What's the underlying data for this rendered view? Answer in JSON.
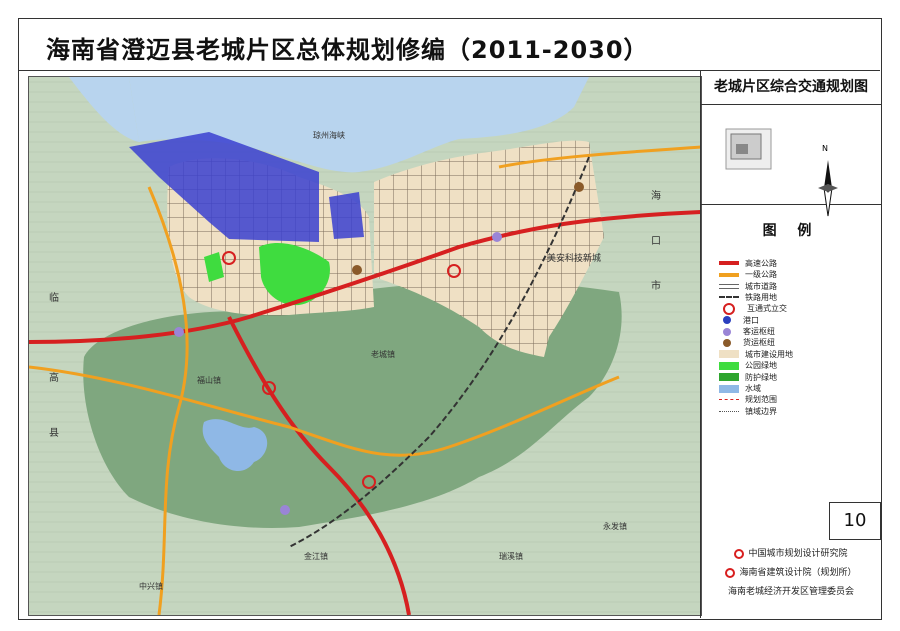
{
  "title": "海南省澄迈县老城片区总体规划修编（2011-2030）",
  "sidebar": {
    "map_title": "老城片区综合交通规划图",
    "compass_label": "N",
    "legend_heading": "图 例",
    "legend": [
      {
        "label": "高速公路",
        "color": "#d62020",
        "style": "thick"
      },
      {
        "label": "一级公路",
        "color": "#f0a020",
        "style": "thick"
      },
      {
        "label": "城市道路",
        "color": "#666666",
        "style": "double"
      },
      {
        "label": "铁路用地",
        "color": "#333333",
        "style": "rail"
      },
      {
        "label": "互通式立交",
        "color": "#d62020",
        "style": "ring"
      },
      {
        "label": "港口",
        "color": "#2b3fbf",
        "style": "anchor"
      },
      {
        "label": "客运枢纽",
        "color": "#9a85d6",
        "style": "dot"
      },
      {
        "label": "货运枢纽",
        "color": "#8a5a2a",
        "style": "dot"
      },
      {
        "label": "城市建设用地",
        "color": "#efe0c4",
        "style": "fill"
      },
      {
        "label": "公园绿地",
        "color": "#3fdc3f",
        "style": "fill"
      },
      {
        "label": "防护绿地",
        "color": "#2ea52e",
        "style": "fill"
      },
      {
        "label": "水域",
        "color": "#8fb8e6",
        "style": "fill"
      },
      {
        "label": "规划范围",
        "color": "#d62020",
        "style": "dash"
      },
      {
        "label": "镇域边界",
        "color": "#555555",
        "style": "dashdot"
      }
    ],
    "page_number": "10",
    "credits": [
      "中国城市规划设计研究院",
      "海南省建筑设计院（规划所）",
      "海南老城经济开发区管理委员会"
    ]
  },
  "map_labels": {
    "strait": "琼州海峡",
    "tech_city": "美安科技新城",
    "town_laocheng": "老城镇",
    "town_fushan": "福山镇",
    "town_jinjiang": "金江镇",
    "town_ruixi": "瑞溪镇",
    "town_yongfa": "永发镇",
    "town_zhongxing": "中兴镇",
    "haikou_a": "海",
    "haikou_b": "口",
    "haikou_c": "市",
    "lingao_a": "临",
    "lingao_b": "高",
    "lingao_c": "县"
  },
  "colors": {
    "terrain": "#7fa77f",
    "terrain_light": "#c8d8c2",
    "sea": "#8fb8e6",
    "urban": "#efe0c4",
    "port": "#3a3fd0",
    "expressway": "#d62020",
    "primary_road": "#f0a020"
  }
}
